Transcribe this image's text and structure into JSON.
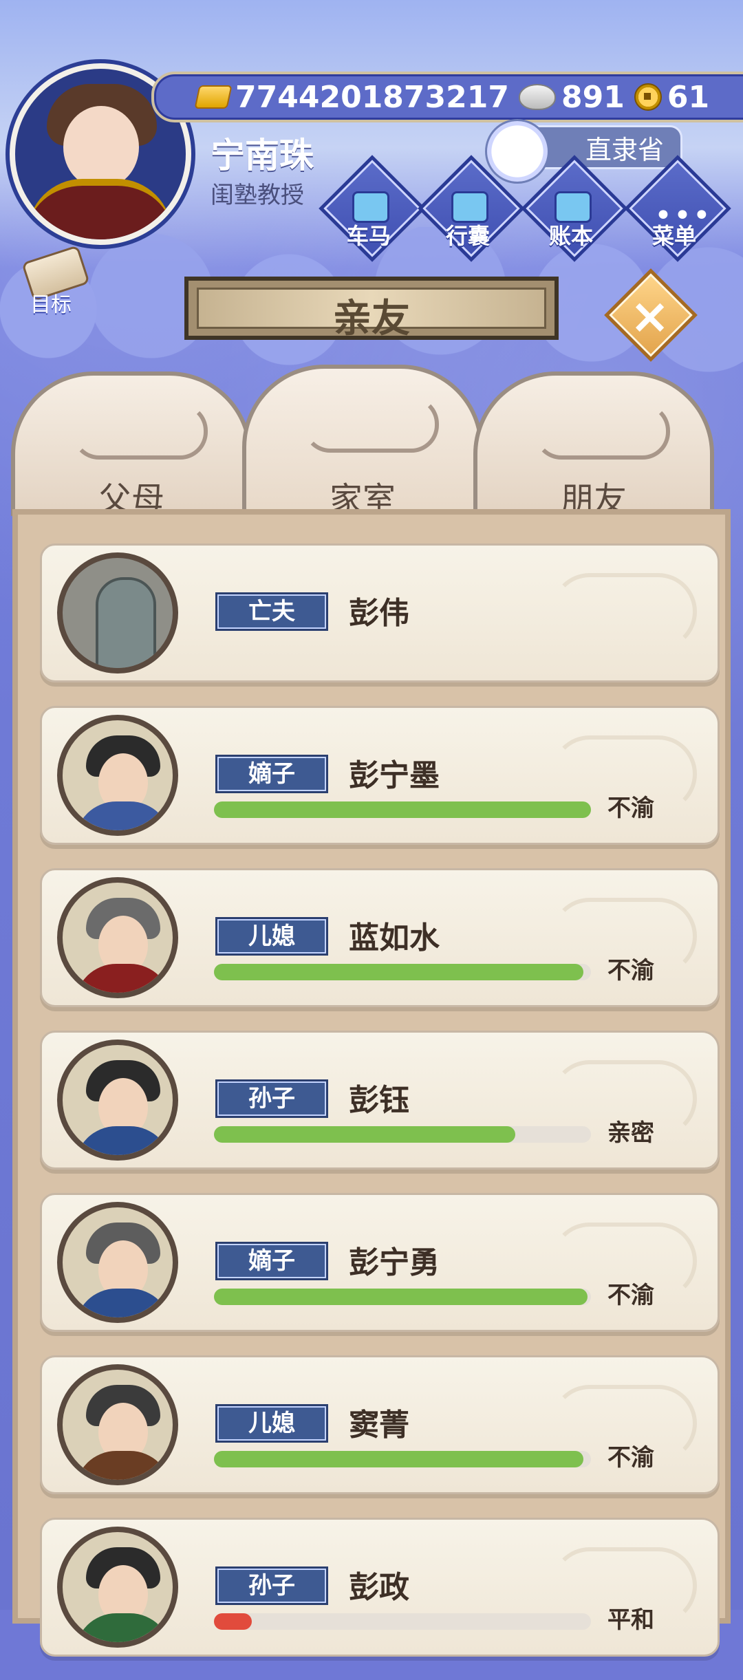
{
  "header": {
    "resources": {
      "gold": "7744201873217",
      "silver": "891",
      "coins": "61"
    },
    "player": {
      "name": "宁南珠",
      "title": "闺塾教授"
    },
    "location": "直隶省",
    "buttons": {
      "cart": "车马",
      "bag": "行囊",
      "ledger": "账本",
      "menu": "菜单",
      "goal": "目标"
    }
  },
  "screen": {
    "title": "亲友",
    "tabs": [
      {
        "label": "父母"
      },
      {
        "label": "家室"
      },
      {
        "label": "朋友"
      }
    ]
  },
  "relatives": [
    {
      "role": "亡夫",
      "name": "彭伟"
    },
    {
      "role": "嫡子",
      "name": "彭宁墨",
      "mood": "不渝",
      "affinity_percent": 100,
      "bar_color": "green"
    },
    {
      "role": "儿媳",
      "name": "蓝如水",
      "mood": "不渝",
      "affinity_percent": 98,
      "bar_color": "green"
    },
    {
      "role": "孙子",
      "name": "彭钰",
      "mood": "亲密",
      "affinity_percent": 80,
      "bar_color": "green"
    },
    {
      "role": "嫡子",
      "name": "彭宁勇",
      "mood": "不渝",
      "affinity_percent": 99,
      "bar_color": "green"
    },
    {
      "role": "儿媳",
      "name": "窦菁",
      "mood": "不渝",
      "affinity_percent": 98,
      "bar_color": "green"
    },
    {
      "role": "孙子",
      "name": "彭政",
      "mood": "平和",
      "affinity_percent": 10,
      "bar_color": "red"
    }
  ]
}
